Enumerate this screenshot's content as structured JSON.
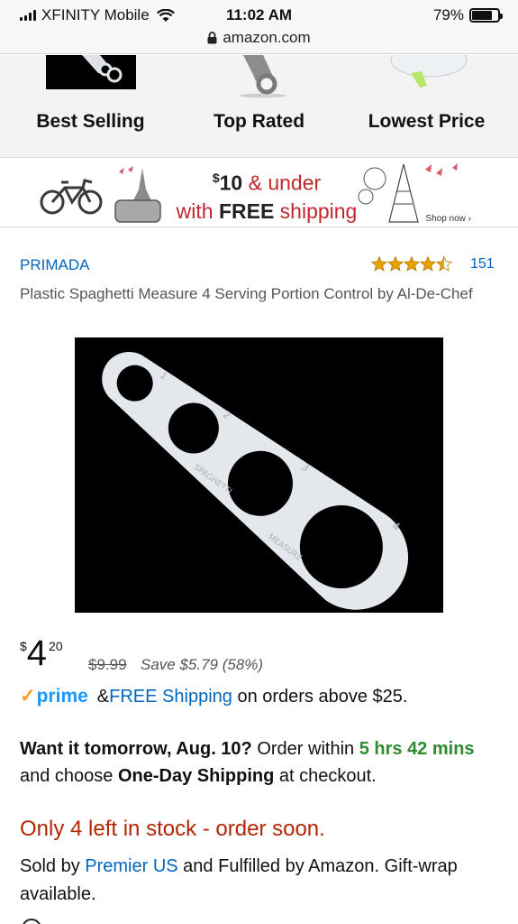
{
  "status_bar": {
    "carrier": "XFINITY Mobile",
    "time": "11:02 AM",
    "battery": "79%",
    "battery_level": 0.79,
    "url": "amazon.com"
  },
  "categories": [
    {
      "label": "Best Selling"
    },
    {
      "label": "Top Rated"
    },
    {
      "label": "Lowest Price"
    }
  ],
  "banner": {
    "dollar_sign": "$",
    "amount": "10",
    "under": " & under",
    "with": "with ",
    "free": "FREE",
    "shipping": " shipping",
    "shop_now": "Shop now ›"
  },
  "product": {
    "brand": "PRIMADA",
    "rating_stars": 4.5,
    "review_count": "151",
    "title": "Plastic Spaghetti Measure 4 Serving Portion Control by Al-De-Chef",
    "image_labels": {
      "spaghetti": "SPAGHETTI",
      "measure": "MEASURE",
      "n1": "1",
      "n2": "2",
      "n3": "3",
      "n4": "4"
    },
    "price": {
      "currency": "$",
      "whole": "4",
      "fraction": "20"
    },
    "list_price": "$9.99",
    "savings": "Save $5.79 (58%)",
    "prime": {
      "logo": "prime",
      "amp": "& ",
      "free_shipping": "FREE Shipping",
      "suffix": " on orders above $25."
    },
    "delivery": {
      "want": "Want it tomorrow, Aug. 10?",
      "order_within": " Order within ",
      "time_left": "5 hrs 42 mins",
      "and_choose": " and choose ",
      "method": "One-Day Shipping",
      "at_checkout": " at checkout."
    },
    "stock": "Only 4 left in stock - order soon.",
    "sold_by": {
      "prefix": "Sold by ",
      "seller": "Premier US",
      "suffix": " and Fulfilled by Amazon. Gift-wrap available."
    }
  },
  "colors": {
    "link": "#0066c0",
    "stock": "#b12704",
    "green": "#2e8b2e",
    "star": "#e8a200",
    "prime_blue": "#1a98ff",
    "prime_check": "#f79c24"
  }
}
